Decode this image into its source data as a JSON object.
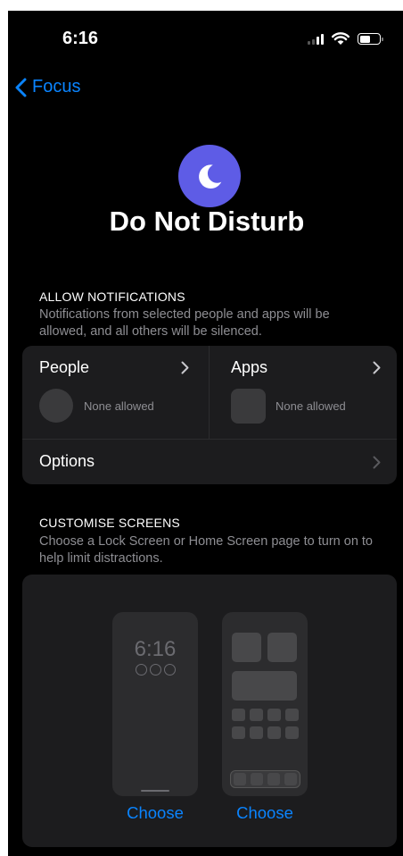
{
  "status_bar": {
    "time": "6:16"
  },
  "nav": {
    "back_label": "Focus"
  },
  "header": {
    "title": "Do Not Disturb",
    "accent_color": "#5e5ce6",
    "icon": "moon-icon"
  },
  "allow_notifications": {
    "heading": "ALLOW NOTIFICATIONS",
    "description": "Notifications from selected people and apps will be allowed, and all others will be silenced.",
    "people": {
      "label": "People",
      "status": "None allowed"
    },
    "apps": {
      "label": "Apps",
      "status": "None allowed"
    },
    "options_label": "Options"
  },
  "customise_screens": {
    "heading": "CUSTOMISE SCREENS",
    "description": "Choose a Lock Screen or Home Screen page to turn on to help limit distractions.",
    "lock_screen_time": "6:16",
    "choose_lock_label": "Choose",
    "choose_home_label": "Choose"
  },
  "colors": {
    "link": "#0a84ff",
    "background": "#000000",
    "card": "#1c1c1e"
  }
}
